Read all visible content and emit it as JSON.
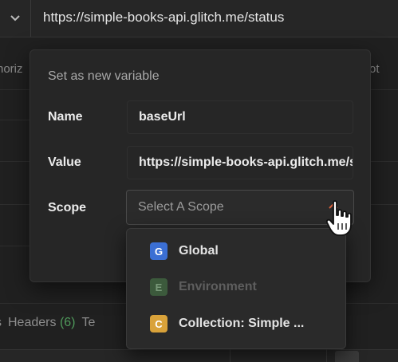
{
  "request": {
    "url": "https://simple-books-api.glitch.me/status",
    "tab_left_partial": "horiz",
    "tab_right_partial": "ot"
  },
  "footer_tabs": {
    "partial_left": "s",
    "headers_label": "Headers",
    "headers_count": "(6)",
    "partial_right": "Te"
  },
  "modal": {
    "title": "Set as new variable",
    "name_label": "Name",
    "name_value": "baseUrl",
    "value_label": "Value",
    "value_value": "https://simple-books-api.glitch.me/status",
    "scope_label": "Scope",
    "scope_placeholder": "Select A Scope"
  },
  "scope_options": [
    {
      "badge": "G",
      "label": "Global",
      "color": "#3b6fd4",
      "enabled": true
    },
    {
      "badge": "E",
      "label": "Environment",
      "color": "#3c5a3c",
      "enabled": false
    },
    {
      "badge": "C",
      "label": "Collection: Simple ...",
      "color": "#d9a23a",
      "enabled": true
    }
  ],
  "colors": {
    "accent_send": "#b45a3c",
    "headers_count_green": "#4f9a5b"
  },
  "icons": {
    "method_dropdown": "chevron-down-icon",
    "scope_dropdown": "chevron-up-icon",
    "cursor": "hand-pointer-icon"
  }
}
